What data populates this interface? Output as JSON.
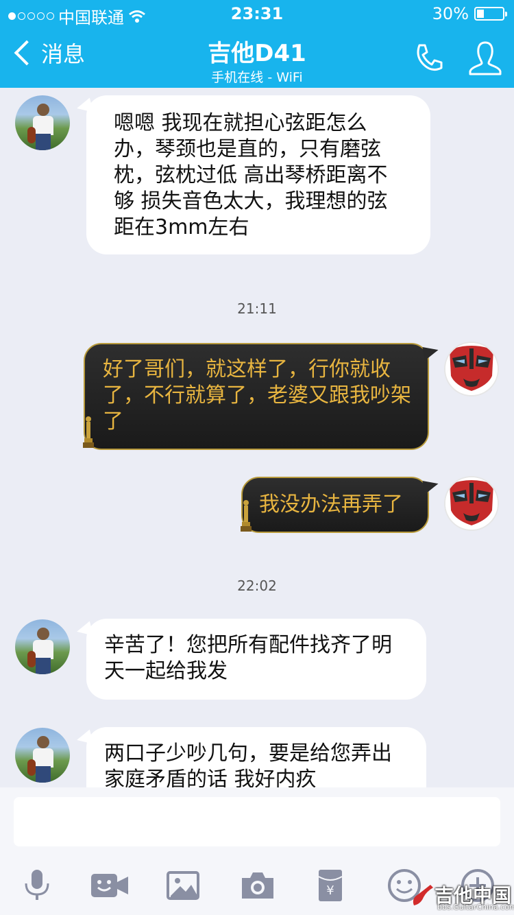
{
  "status": {
    "carrier": "中国联通",
    "time": "23:31",
    "battery": "30%",
    "battery_level": 0.3,
    "signal_bars": 1
  },
  "nav": {
    "back_label": "消息",
    "title": "吉他D41",
    "subtitle": "手机在线 - WiFi"
  },
  "messages": [
    {
      "side": "left",
      "text": "嗯嗯 我现在就担心弦距怎么办，琴颈也是直的，只有磨弦枕，弦枕过低 高出琴桥距离不够 损失音色太大，我理想的弦距在3mm左右"
    },
    {
      "type": "time",
      "text": "21:11"
    },
    {
      "side": "right",
      "text": "好了哥们，就这样了，行你就收了，不行就算了，老婆又跟我吵架了"
    },
    {
      "side": "right",
      "text": "我没办法再弄了"
    },
    {
      "type": "time",
      "text": "22:02"
    },
    {
      "side": "left",
      "text": "辛苦了！您把所有配件找齐了明天一起给我发"
    },
    {
      "side": "left",
      "text": "两口子少吵几句，要是给您弄出家庭矛盾的话 我好内疚"
    }
  ],
  "toolbar": {
    "icons": [
      "microphone-icon",
      "video-icon",
      "image-icon",
      "camera-icon",
      "red-envelope-icon",
      "emoji-icon",
      "plus-icon"
    ]
  },
  "watermark": {
    "brand": "吉他中国",
    "url": "bbs.GuitarChina.com"
  },
  "colors": {
    "accent": "#18b4ed",
    "bubble_gold": "#e8b540"
  }
}
